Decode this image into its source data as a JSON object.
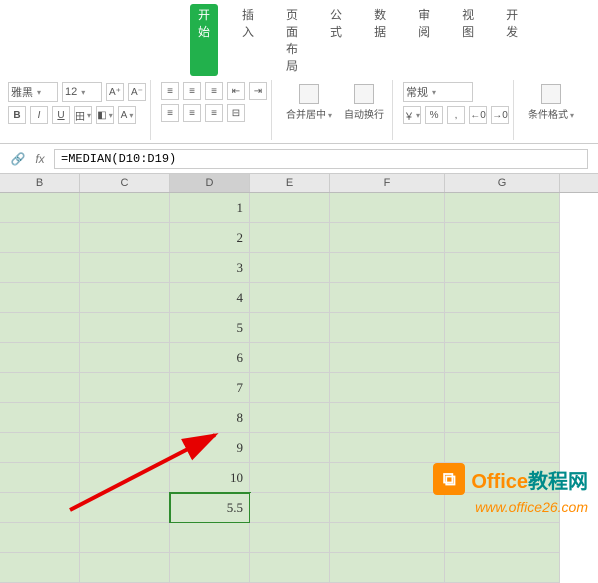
{
  "tabs": {
    "start": "开始",
    "insert": "插入",
    "pagelayout": "页面布局",
    "formula": "公式",
    "data": "数据",
    "review": "审阅",
    "view": "视图",
    "dev": "开发"
  },
  "font": {
    "name": "雅黑",
    "size": "12"
  },
  "format": {
    "general": "常规",
    "merge": "合并居中",
    "wrap": "自动换行",
    "cond": "条件格式"
  },
  "symbols": {
    "currency": "￥",
    "percent": "%",
    "comma": ",00",
    "decInc": ".0",
    "decDec": ".00"
  },
  "formula_bar": {
    "fx": "fx",
    "value": "=MEDIAN(D10:D19)"
  },
  "columns": {
    "B": "B",
    "C": "C",
    "D": "D",
    "E": "E",
    "F": "F",
    "G": "G"
  },
  "cells": {
    "d1": "1",
    "d2": "2",
    "d3": "3",
    "d4": "4",
    "d5": "5",
    "d6": "6",
    "d7": "7",
    "d8": "8",
    "d9": "9",
    "d10": "10",
    "d11": "5.5"
  },
  "watermark": {
    "title_prefix": "Office",
    "title_suffix": "教程网",
    "url": "www.office26.com"
  }
}
